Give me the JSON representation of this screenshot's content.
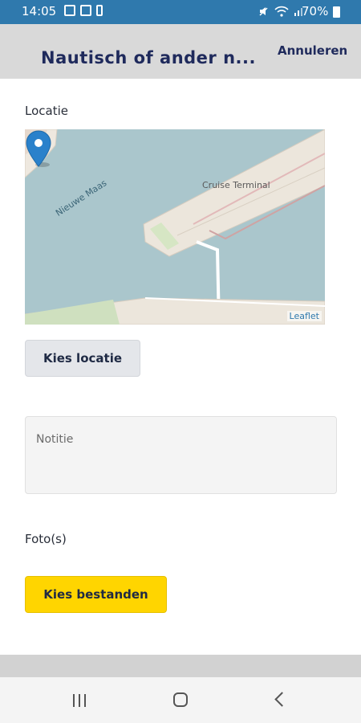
{
  "status_bar": {
    "time": "14:05",
    "battery": "70%"
  },
  "header": {
    "title": "Nautisch of ander n...",
    "cancel_label": "Annuleren"
  },
  "form": {
    "location_label": "Locatie",
    "choose_location_label": "Kies locatie",
    "note_placeholder": "Notitie",
    "photos_label": "Foto(s)",
    "choose_files_label": "Kies bestanden"
  },
  "map": {
    "water_label": "Nieuwe Maas",
    "terminal_label": "Cruise Terminal",
    "attribution": "Leaflet",
    "icons": [
      "map-marker-icon"
    ]
  },
  "colors": {
    "status_bar": "#2f79ad",
    "header_bg": "#d9d9d9",
    "accent_yellow": "#ffd500",
    "title_color": "#1f2a5c",
    "water": "#aac6cc",
    "marker": "#2a81cb"
  },
  "nav_icons": [
    "recents-icon",
    "home-icon",
    "back-icon"
  ]
}
